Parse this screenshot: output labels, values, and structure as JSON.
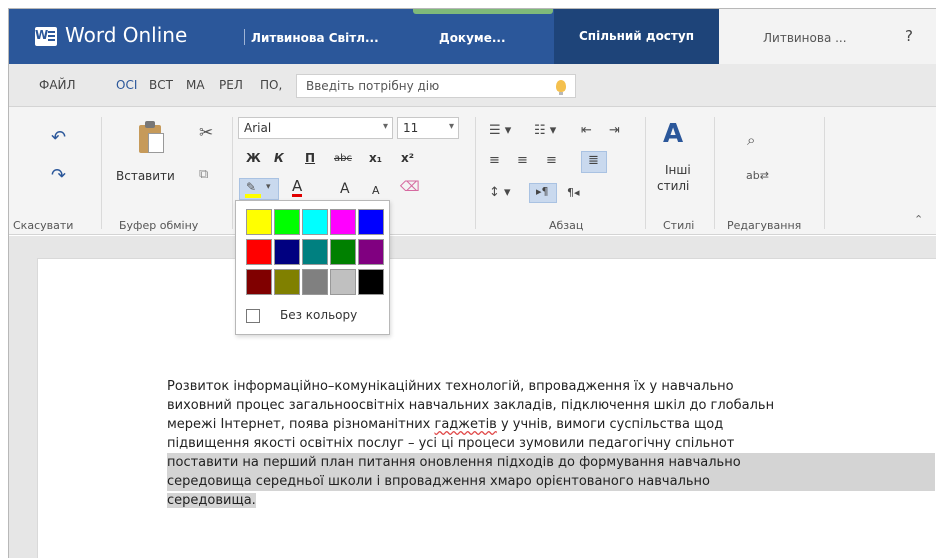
{
  "titlebar": {
    "app_name": "Word Online",
    "user_short": "Литвинова Світл...",
    "document_name": "Докуме...",
    "share_label": "Спільний доступ",
    "account_name": "Литвинова ...",
    "help": "?"
  },
  "tabs": [
    "ФАЙЛ",
    "ОСІ",
    "ВСТ",
    "МА",
    "РЕЛ",
    "ПО,"
  ],
  "search": {
    "placeholder": "Введіть потрібну дію"
  },
  "ribbon": {
    "undo_group": "Скасувати",
    "clipboard": {
      "paste": "Вставити",
      "group": "Буфер обміну"
    },
    "font": {
      "name": "Arial",
      "size": "11",
      "bold": "Ж",
      "italic": "К",
      "underline": "П",
      "strike": "abc",
      "sub": "x₁",
      "sup": "x²",
      "font_color": "A",
      "grow": "A",
      "shrink": "A"
    },
    "paragraph": {
      "group": "Абзац"
    },
    "styles": {
      "line1": "Інші",
      "line2": "стилі",
      "group": "Стилі"
    },
    "editing": {
      "group": "Редагування"
    }
  },
  "highlight_palette": {
    "colors": [
      "#ffff00",
      "#00ff00",
      "#00ffff",
      "#ff00ff",
      "#0000ff",
      "#ff0000",
      "#000080",
      "#008080",
      "#008000",
      "#800080",
      "#800000",
      "#808000",
      "#808080",
      "#c0c0c0",
      "#000000"
    ],
    "no_color": "Без кольору"
  },
  "document": {
    "lines": [
      "Розвиток  інформаційно–комунікаційних  технологій,  впровадження  їх  у  навчально",
      "виховний процес загальноосвітніх навчальних закладів, підключення шкіл до глобальн",
      "мережі  Інтернет,  поява  різноманітних ",
      "підвищення  якості  освітніх  послуг  –  усі  ці  процеси  зумовили  педагогічну  спільнот",
      "поставити  на  перший  план  питання  оновлення  підходів  до  формування  навчально",
      "середовища   середньої   школи   і   впровадження   хмаро   орієнтованого   навчально",
      "середовища."
    ],
    "misspelled": "гаджетів",
    "line3_tail": " у  учнів,  вимоги  суспільства  щод"
  }
}
